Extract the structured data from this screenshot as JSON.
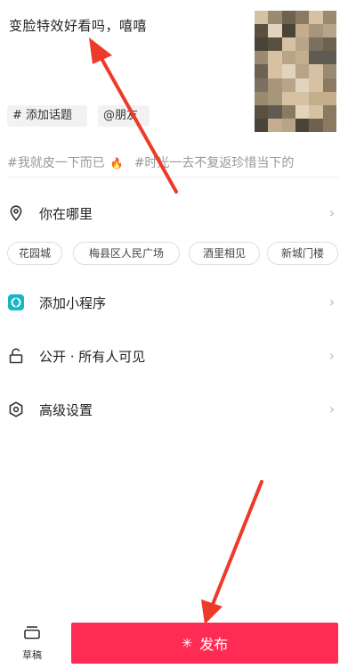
{
  "caption": "变脸特效好看吗，嘻嘻",
  "cover_thumbnail": "pixelated-face-cover",
  "chips": {
    "topic": "# 添加话题",
    "friend": "@朋友"
  },
  "suggested_topics": [
    {
      "text": "#我就皮一下而已"
    },
    {
      "text": "#时光一去不复返珍惜当下的"
    }
  ],
  "flame_icon": "flame-icon",
  "location": {
    "label": "你在哪里",
    "icon": "location-pin-icon",
    "options": [
      "花园城",
      "梅县区人民广场",
      "酒里相见",
      "新城门楼"
    ]
  },
  "mini_program": {
    "label": "添加小程序",
    "icon": "mini-program-icon",
    "accent": "#16b6c6"
  },
  "visibility": {
    "label": "公开 · 所有人可见",
    "icon": "unlock-icon"
  },
  "advanced": {
    "label": "高级设置",
    "icon": "hexagon-settings-icon"
  },
  "bottom_bar": {
    "draft_label": "草稿",
    "publish_label": "发布",
    "publish_color": "#fe2c55"
  },
  "annotation_color": "#ee3a2a"
}
